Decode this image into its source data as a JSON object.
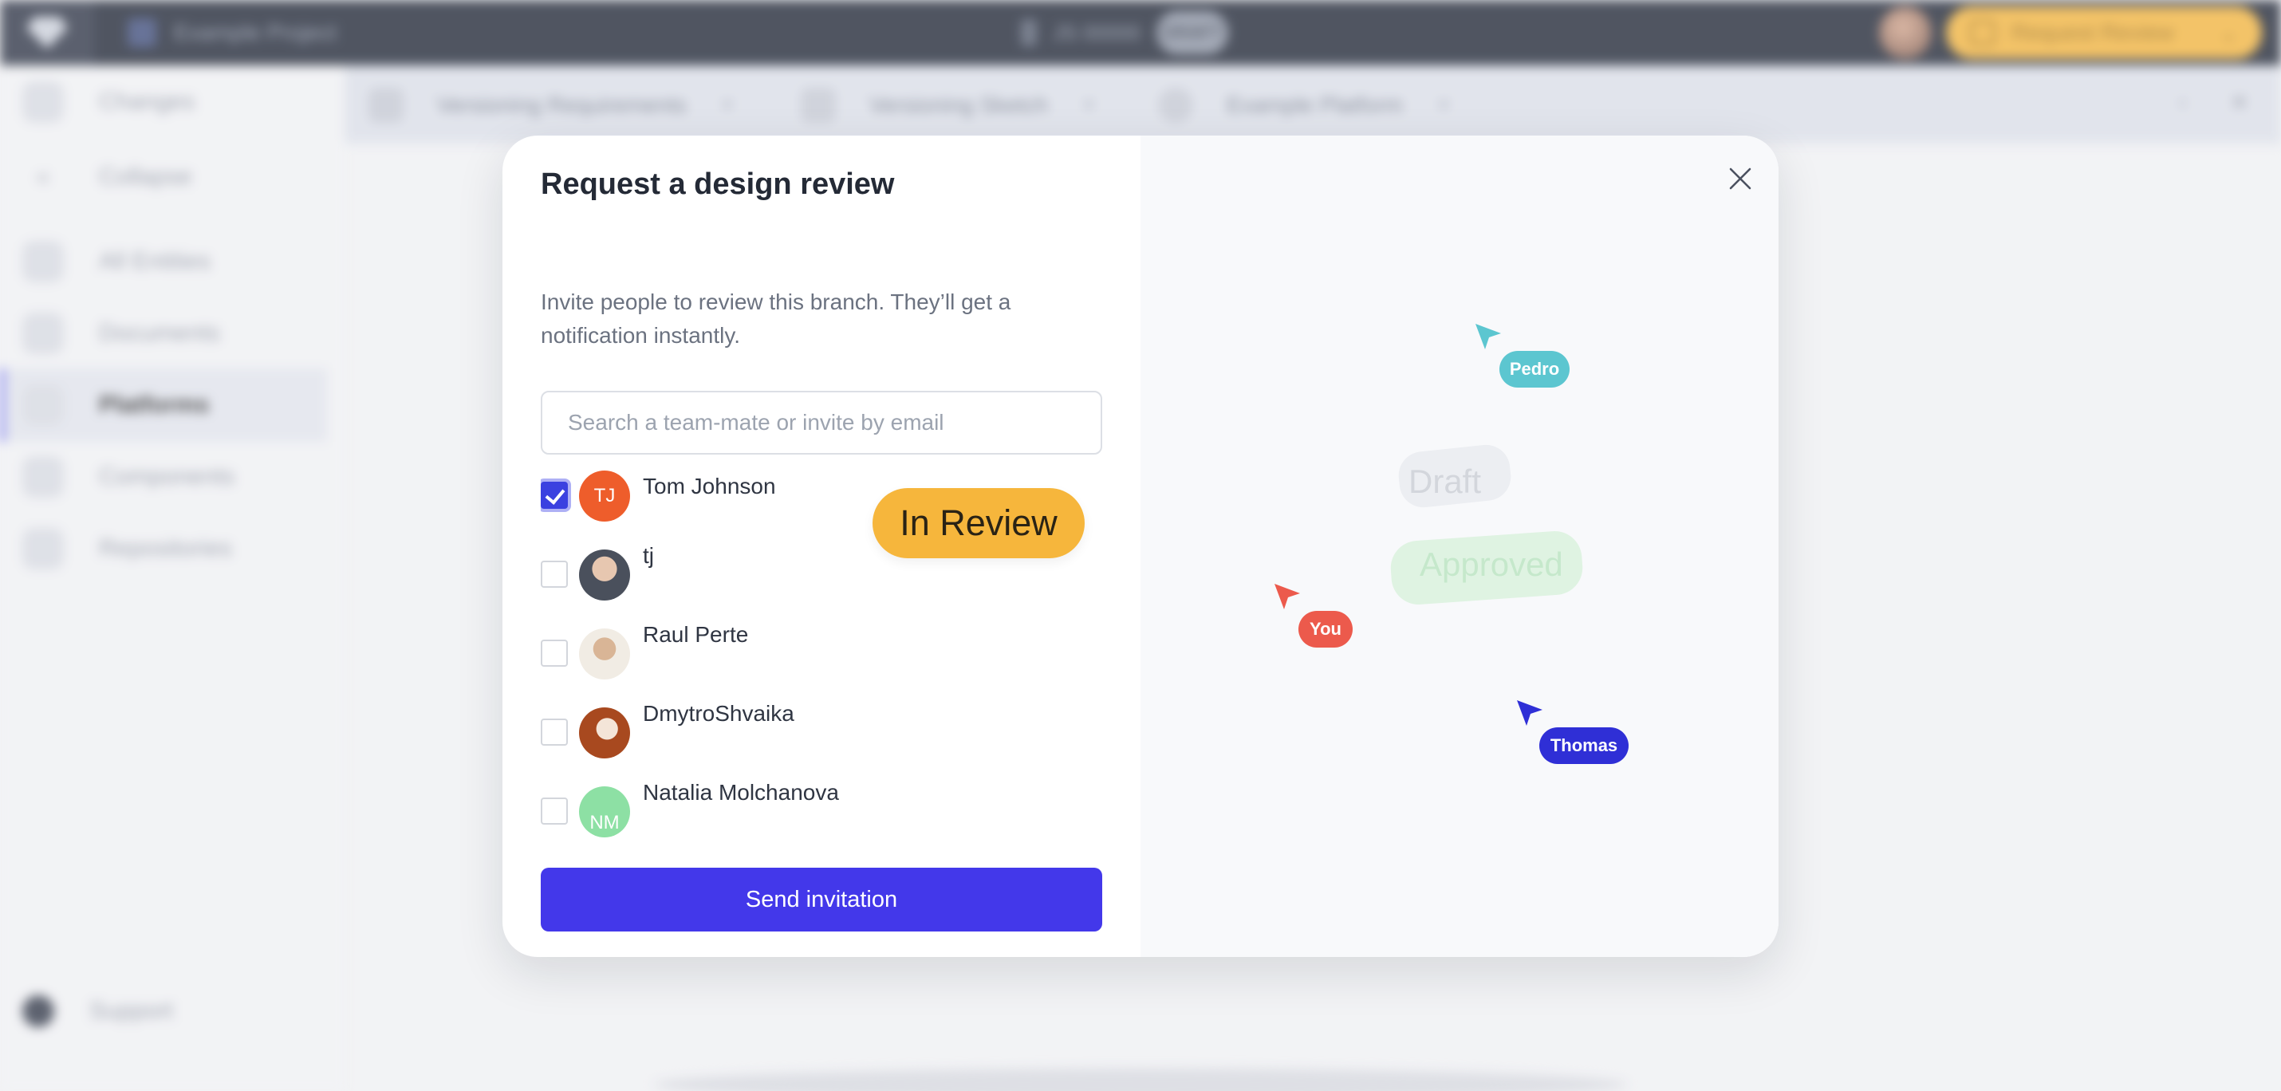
{
  "app": {
    "project_name": "Example Project",
    "session_text": "JS 00000",
    "session_chip": "DRAFT",
    "request_review_label": "Request Review",
    "sidebar": {
      "items": [
        {
          "label": "Changes"
        },
        {
          "label": "Collapse"
        },
        {
          "label": "All Entities"
        },
        {
          "label": "Documents"
        },
        {
          "label": "Platforms"
        },
        {
          "label": "Components"
        },
        {
          "label": "Repositories"
        }
      ],
      "support": "Support"
    },
    "tabs": [
      {
        "label": "Versioning Requirements"
      },
      {
        "label": "Versioning Sketch"
      },
      {
        "label": "Example Platform"
      }
    ]
  },
  "modal": {
    "title": "Request a design review",
    "description": "Invite people to review this branch. They’ll get a notification instantly.",
    "search_placeholder": "Search a team-mate or invite by email",
    "people": [
      {
        "name": "Tom Johnson",
        "initials": "TJ",
        "checked": true,
        "avatar_color": "#ee5d2b"
      },
      {
        "name": "tj",
        "initials": "",
        "checked": false,
        "avatar_color": "#5b6470"
      },
      {
        "name": "Raul Perte",
        "initials": "",
        "checked": false,
        "avatar_color": "#c9b8a3"
      },
      {
        "name": "DmytroShvaika",
        "initials": "",
        "checked": false,
        "avatar_color": "#b5562b"
      },
      {
        "name": "Natalia Molchanova",
        "initials": "NM",
        "checked": false,
        "avatar_color": "#8de0a4"
      }
    ],
    "send_label": "Send invitation",
    "illustration": {
      "status_main": "In Review",
      "status_behind_top": "Draft",
      "status_behind_bottom": "Approved",
      "cursors": [
        {
          "name": "Pedro",
          "color": "#5cc6d0"
        },
        {
          "name": "You",
          "color": "#ec5a4c"
        },
        {
          "name": "Thomas",
          "color": "#2f2fd6"
        }
      ]
    }
  }
}
